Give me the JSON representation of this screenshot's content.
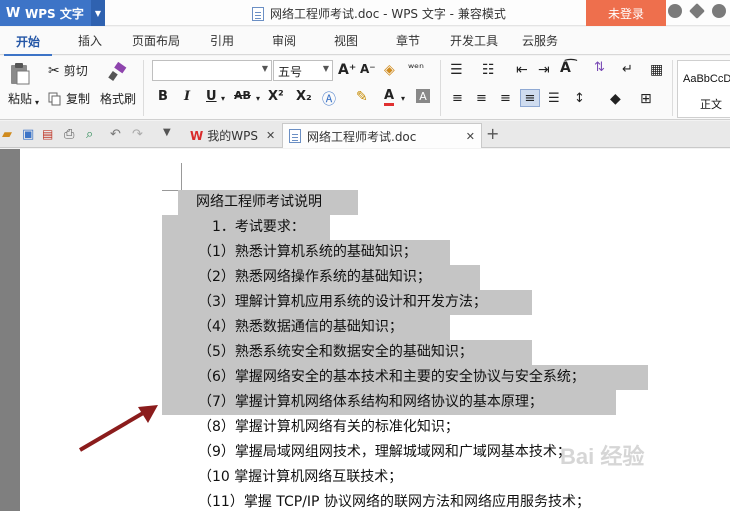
{
  "titlebar": {
    "app_name": "WPS 文字",
    "doc_title": "网络工程师考试.doc - WPS 文字 - 兼容模式",
    "login_label": "未登录"
  },
  "menu": {
    "tabs": [
      "开始",
      "插入",
      "页面布局",
      "引用",
      "审阅",
      "视图",
      "章节",
      "开发工具",
      "云服务"
    ]
  },
  "ribbon": {
    "paste_label": "粘贴",
    "cut_label": "剪切",
    "copy_label": "复制",
    "format_painter_label": "格式刷",
    "font_name_value": "",
    "font_size_value": "五号",
    "bold": "B",
    "italic": "I",
    "underline": "U",
    "strike": "AB",
    "superscript": "X²",
    "subscript": "X₂",
    "font_color_letter": "A",
    "style_sample": "AaBbCcDd",
    "style_name": "正文"
  },
  "docbar": {
    "tabs": [
      {
        "label": "我的WPS"
      },
      {
        "label": "网络工程师考试.doc"
      }
    ]
  },
  "document": {
    "lines": [
      "网络工程师考试说明",
      "1．考试要求：",
      "（1）熟悉计算机系统的基础知识；",
      "（2）熟悉网络操作系统的基础知识；",
      "（3）理解计算机应用系统的设计和开发方法；",
      "（4）熟悉数据通信的基础知识；",
      "（5）熟悉系统安全和数据安全的基础知识；",
      "（6）掌握网络安全的基本技术和主要的安全协议与安全系统；",
      "（7）掌握计算机网络体系结构和网络协议的基本原理；",
      "（8）掌握计算机网络有关的标准化知识；",
      "（9）掌握局域网组网技术，理解城域网和广域网基本技术；",
      "（10 掌握计算机网络互联技术；",
      "（11）掌握 TCP/IP 协议网络的联网方法和网络应用服务技术；"
    ],
    "selected_count": 9
  },
  "watermark": "Bai 经验",
  "colors": {
    "accent": "#3d74c7",
    "login": "#ee6f4d",
    "selection": "#c5c5c5",
    "arrow": "#8b1c1c"
  }
}
